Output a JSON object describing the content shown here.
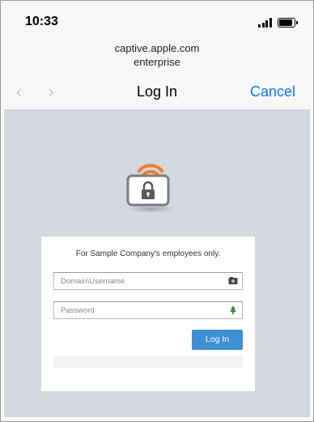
{
  "status_bar": {
    "time": "10:33",
    "signal_icon": "cellular-signal-icon",
    "battery_icon": "battery-icon"
  },
  "header": {
    "host": "captive.apple.com",
    "subtitle": "enterprise"
  },
  "nav": {
    "back_icon": "chevron-left-icon",
    "forward_icon": "chevron-right-icon",
    "title": "Log In",
    "cancel_label": "Cancel"
  },
  "login_card": {
    "notice": "For Sample Company's employees only.",
    "username_placeholder": "Domain\\Username",
    "password_placeholder": "Password",
    "login_label": "Log In"
  },
  "colors": {
    "accent": "#0a7aff",
    "button": "#3f8fd2",
    "background": "#d2d7e0",
    "wifi_orange": "#f07d2d"
  }
}
